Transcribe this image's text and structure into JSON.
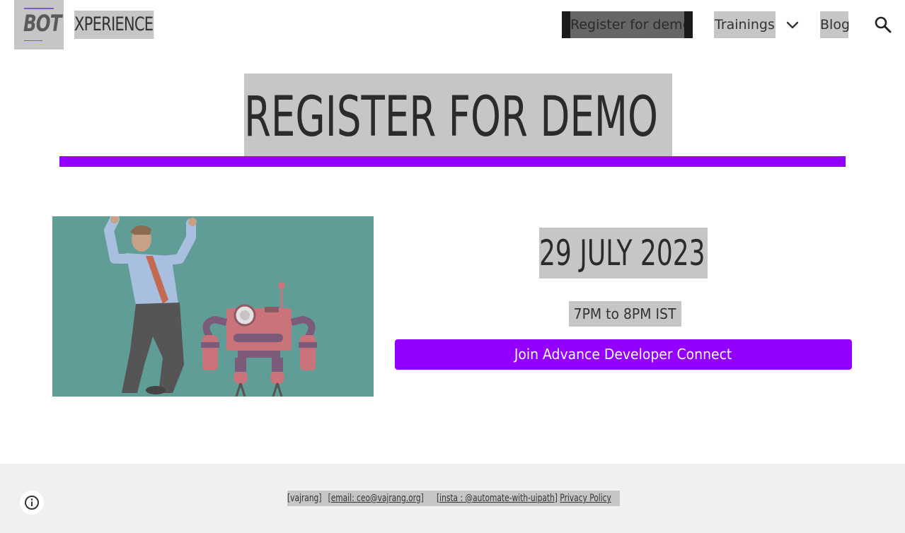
{
  "header": {
    "logo_text": "BOT",
    "site_title": "XPERIENCE",
    "nav": {
      "register": "Register for demo",
      "trainings": "Trainings",
      "blog": "Blog"
    },
    "icons": [
      "chevron-down-icon",
      "search-icon"
    ]
  },
  "main": {
    "heading": "REGISTER FOR DEMO",
    "date": "29 JULY 2023",
    "time": "7PM to 8PM IST",
    "cta_label": "Join Advance Developer Connect"
  },
  "footer": {
    "vajrang": "[vajrang]",
    "email": "[email: ceo@vajrang.org]",
    "insta": "[insta : @automate-with-uipath]",
    "privacy": "Privacy Policy"
  },
  "colors": {
    "accent": "#9400ff",
    "highlight_gray": "#c6c6c6",
    "illustration_bg": "#5f9d96",
    "footer_bg": "#f0f0f0"
  }
}
